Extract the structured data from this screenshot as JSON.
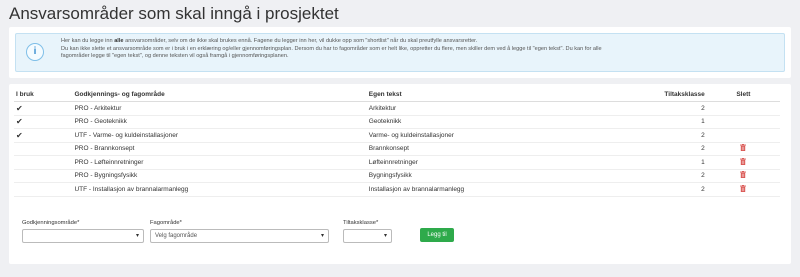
{
  "page": {
    "title": "Ansvarsområder som skal inngå i prosjektet"
  },
  "info": {
    "icon": "info-icon",
    "line1_a": "Her kan du legge inn ",
    "line1_bold": "alle",
    "line1_b": " ansvarsområder, selv om de ikke skal brukes ennå. Fagene du legger inn her, vil dukke opp som \"shortlist\" når du skal preutfylle ansvarsretter.",
    "line2": "Du kan ikke slette et ansvarsområde som er i bruk i en erklæring og/eller gjennomføringsplan. Dersom du har to fagområder som er helt like, oppretter du flere, men skiller dem ved å legge til \"egen tekst\". Du kan for alle",
    "line3": "fagområder legge til \"egen tekst\", og denne teksten vil også framgå i gjennomføringsplanen."
  },
  "table": {
    "headers": {
      "i_bruk": "I bruk",
      "godkjenning": "Godkjennings- og fagområde",
      "egen_tekst": "Egen tekst",
      "tiltaksklasse": "Tiltaksklasse",
      "slett": "Slett"
    },
    "rows": [
      {
        "in_use": true,
        "godkjenning": "PRO - Arkitektur",
        "egen_tekst": "Arkitektur",
        "tiltaksklasse": "2",
        "deletable": false
      },
      {
        "in_use": true,
        "godkjenning": "PRO - Geoteknikk",
        "egen_tekst": "Geoteknikk",
        "tiltaksklasse": "1",
        "deletable": false
      },
      {
        "in_use": true,
        "godkjenning": "UTF - Varme- og kuldeinstallasjoner",
        "egen_tekst": "Varme- og kuldeinstallasjoner",
        "tiltaksklasse": "2",
        "deletable": false
      },
      {
        "in_use": false,
        "godkjenning": "PRO - Brannkonsept",
        "egen_tekst": "Brannkonsept",
        "tiltaksklasse": "2",
        "deletable": true
      },
      {
        "in_use": false,
        "godkjenning": "PRO - Løfteinnretninger",
        "egen_tekst": "Løfteinnretninger",
        "tiltaksklasse": "1",
        "deletable": true
      },
      {
        "in_use": false,
        "godkjenning": "PRO - Bygningsfysikk",
        "egen_tekst": "Bygningsfysikk",
        "tiltaksklasse": "2",
        "deletable": true
      },
      {
        "in_use": false,
        "godkjenning": "UTF - Installasjon av brannalarmanlegg",
        "egen_tekst": "Installasjon av brannalarmanlegg",
        "tiltaksklasse": "2",
        "deletable": true
      }
    ],
    "check_glyph": "✔",
    "check_icon": "checkmark-icon",
    "delete_icon": "trash-icon",
    "delete_color": "#d9534f"
  },
  "form": {
    "godkjenning_label": "Godkjenningsområde*",
    "godkjenning_value": "",
    "fag_label": "Fagområde*",
    "fag_value": "Velg fagområde",
    "tiltak_label": "Tiltaksklasse*",
    "tiltak_value": "",
    "add_button": "Legg til",
    "caret_glyph": "▾"
  },
  "colors": {
    "background": "#eff0f3",
    "info_bg": "#e8f4fb",
    "add_button": "#2eaa4b"
  }
}
